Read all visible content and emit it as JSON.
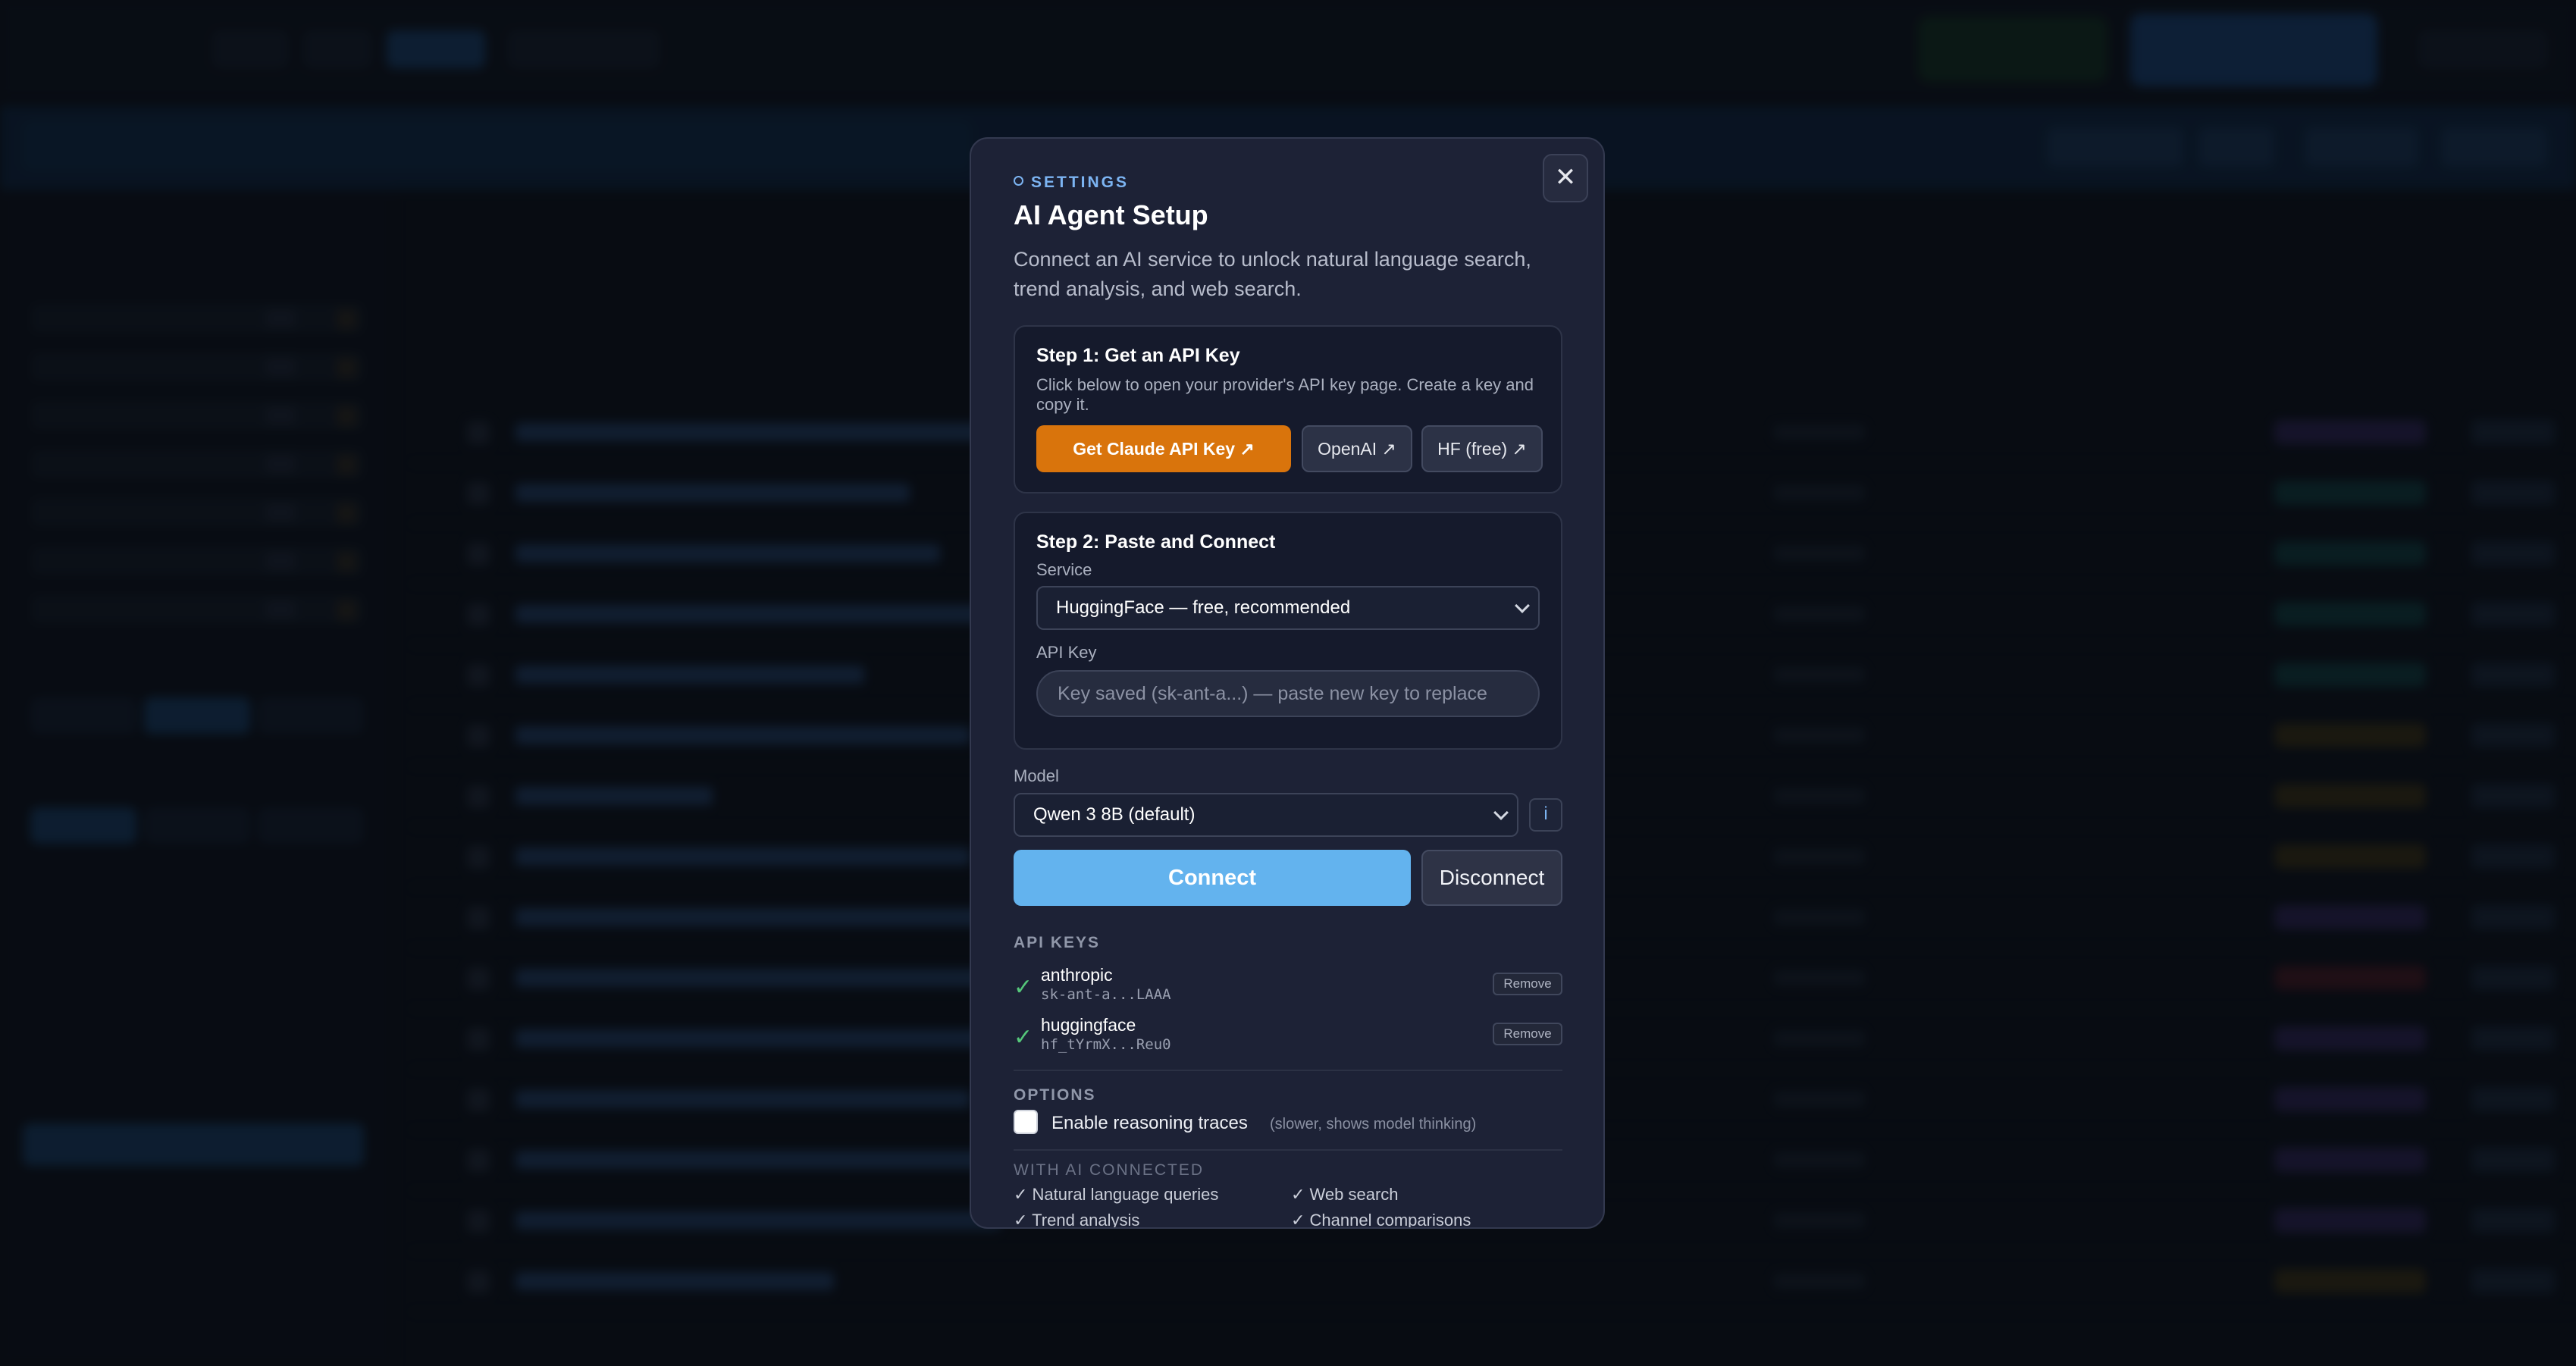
{
  "modal": {
    "eyebrow": "SETTINGS",
    "title": "AI Agent Setup",
    "description": "Connect an AI service to unlock natural language search, trend analysis, and web search.",
    "close_label": "✕",
    "step1": {
      "heading": "Step 1: Get an API Key",
      "text": "Click below to open your provider's API key page. Create a key and copy it.",
      "buttons": {
        "claude": "Get Claude API Key ↗",
        "openai": "OpenAI ↗",
        "hf": "HF (free) ↗"
      }
    },
    "step2": {
      "heading": "Step 2: Paste and Connect",
      "service_label": "Service",
      "service_value": "HuggingFace — free, recommended",
      "api_key_label": "API Key",
      "api_key_placeholder": "Key saved (sk-ant-a...) — paste new key to replace"
    },
    "model": {
      "label": "Model",
      "value": "Qwen 3 8B (default)",
      "info_label": "i"
    },
    "connect_label": "Connect",
    "disconnect_label": "Disconnect",
    "api_keys": {
      "heading": "API KEYS",
      "items": [
        {
          "check": "✓",
          "provider": "anthropic",
          "masked": "sk-ant-a...LAAA",
          "remove": "Remove"
        },
        {
          "check": "✓",
          "provider": "huggingface",
          "masked": "hf_tYrmX...Reu0",
          "remove": "Remove"
        }
      ]
    },
    "options": {
      "heading": "OPTIONS",
      "reasoning_label": "Enable reasoning traces",
      "reasoning_note": "(slower, shows model thinking)",
      "reasoning_checked": false
    },
    "features": {
      "heading": "WITH AI CONNECTED",
      "items": [
        "✓ Natural language queries",
        "✓ Web search",
        "✓ Trend analysis",
        "✓ Channel comparisons"
      ]
    }
  },
  "colors": {
    "accent": "#63b3ee",
    "claude_orange": "#d9740c",
    "modal_bg": "#1d2236",
    "ok_green": "#55c77a"
  }
}
